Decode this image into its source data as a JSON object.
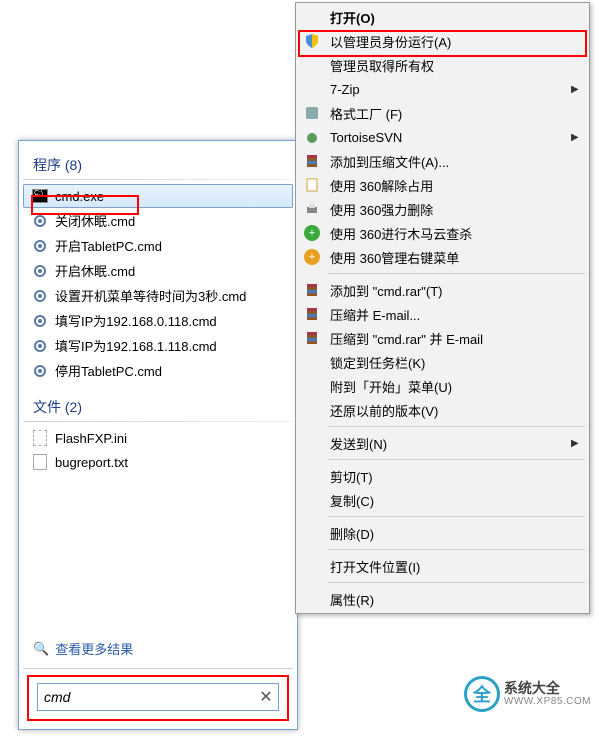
{
  "start_menu": {
    "programs_header": "程序 (8)",
    "files_header": "文件 (2)",
    "programs": [
      {
        "label": "cmd.exe",
        "icon": "cmd",
        "selected": true
      },
      {
        "label": "关闭休眠.cmd",
        "icon": "gear"
      },
      {
        "label": "开启TabletPC.cmd",
        "icon": "gear"
      },
      {
        "label": "开启休眠.cmd",
        "icon": "gear"
      },
      {
        "label": "设置开机菜单等待时间为3秒.cmd",
        "icon": "gear"
      },
      {
        "label": "填写IP为192.168.0.118.cmd",
        "icon": "gear"
      },
      {
        "label": "填写IP为192.168.1.118.cmd",
        "icon": "gear"
      },
      {
        "label": "停用TabletPC.cmd",
        "icon": "gear"
      }
    ],
    "files": [
      {
        "label": "FlashFXP.ini",
        "icon": "ini"
      },
      {
        "label": "bugreport.txt",
        "icon": "txt"
      }
    ],
    "see_more": "查看更多结果",
    "search_value": "cmd"
  },
  "context_menu": {
    "groups": [
      [
        {
          "label": "打开(O)",
          "icon": "",
          "default": true
        },
        {
          "label": "以管理员身份运行(A)",
          "icon": "shield",
          "highlighted": true
        },
        {
          "label": "管理员取得所有权",
          "icon": ""
        },
        {
          "label": "7-Zip",
          "icon": "",
          "submenu": true
        },
        {
          "label": "格式工厂 (F)",
          "icon": "format"
        },
        {
          "label": "TortoiseSVN",
          "icon": "tortoise",
          "submenu": true
        },
        {
          "label": "添加到压缩文件(A)...",
          "icon": "rar"
        },
        {
          "label": "使用 360解除占用",
          "icon": "doc"
        },
        {
          "label": "使用 360强力删除",
          "icon": "printer"
        },
        {
          "label": "使用 360进行木马云查杀",
          "icon": "360g"
        },
        {
          "label": "使用 360管理右键菜单",
          "icon": "360y"
        }
      ],
      [
        {
          "label": "添加到 \"cmd.rar\"(T)",
          "icon": "rar"
        },
        {
          "label": "压缩并 E-mail...",
          "icon": "rar"
        },
        {
          "label": "压缩到 \"cmd.rar\" 并 E-mail",
          "icon": "rar"
        },
        {
          "label": "锁定到任务栏(K)",
          "icon": ""
        },
        {
          "label": "附到「开始」菜单(U)",
          "icon": ""
        },
        {
          "label": "还原以前的版本(V)",
          "icon": ""
        }
      ],
      [
        {
          "label": "发送到(N)",
          "icon": "",
          "submenu": true
        }
      ],
      [
        {
          "label": "剪切(T)",
          "icon": ""
        },
        {
          "label": "复制(C)",
          "icon": ""
        }
      ],
      [
        {
          "label": "删除(D)",
          "icon": ""
        }
      ],
      [
        {
          "label": "打开文件位置(I)",
          "icon": ""
        }
      ],
      [
        {
          "label": "属性(R)",
          "icon": ""
        }
      ]
    ]
  },
  "logo": {
    "main": "系统大全",
    "sub": "WWW.XP85.COM"
  }
}
